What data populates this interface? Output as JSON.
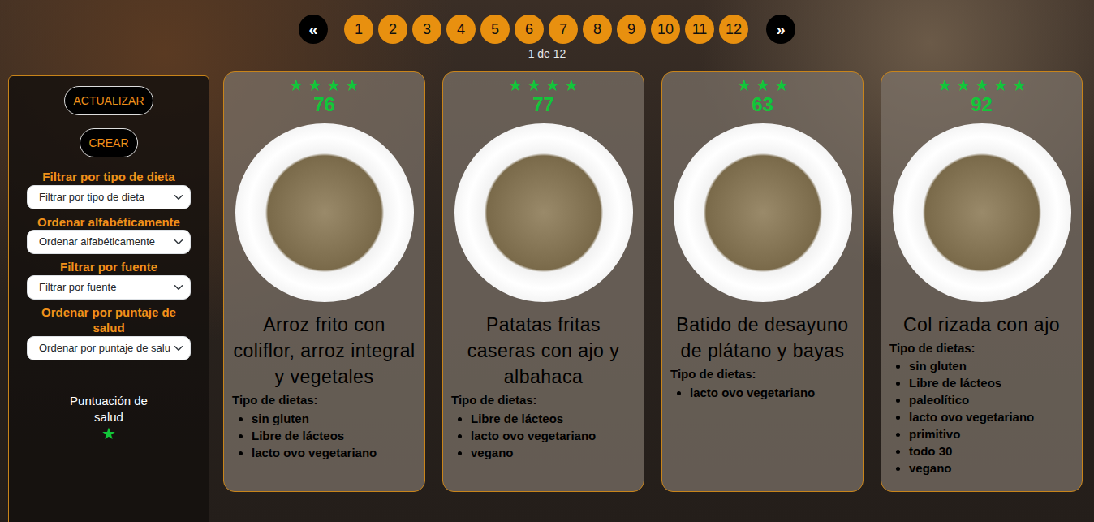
{
  "pagination": {
    "prev": "«",
    "next": "»",
    "pages": [
      "1",
      "2",
      "3",
      "4",
      "5",
      "6",
      "7",
      "8",
      "9",
      "10",
      "11",
      "12"
    ],
    "summary": "1 de 12"
  },
  "sidebar": {
    "buttons": [
      "ACTUALIZAR",
      "CREAR"
    ],
    "filters": [
      {
        "label": "Filtrar por tipo de dieta",
        "value": "Filtrar por tipo de dieta"
      },
      {
        "label": "Ordenar alfabéticamente",
        "value": "Ordenar alfabéticamente"
      },
      {
        "label": "Filtrar por fuente",
        "value": "Filtrar por fuente"
      },
      {
        "label": "Ordenar por puntaje de salud",
        "value": "Ordenar por puntaje de salu"
      }
    ],
    "legend": {
      "label": "Puntuación de salud",
      "stars": 1
    }
  },
  "recipes": [
    {
      "stars": 4,
      "score": "76",
      "title": "Arroz frito con coliflor, arroz integral y vegetales",
      "diets_label": "Tipo de dietas:",
      "diets": [
        "sin gluten",
        "Libre de lácteos",
        "lacto ovo vegetariano"
      ]
    },
    {
      "stars": 4,
      "score": "77",
      "title": "Patatas fritas caseras con ajo y albahaca",
      "diets_label": "Tipo de dietas:",
      "diets": [
        "Libre de lácteos",
        "lacto ovo vegetariano",
        "vegano"
      ]
    },
    {
      "stars": 3,
      "score": "63",
      "title": "Batido de desayuno de plátano y bayas",
      "diets_label": "Tipo de dietas:",
      "diets": [
        "lacto ovo vegetariano"
      ]
    },
    {
      "stars": 5,
      "score": "92",
      "title": "Col rizada con ajo",
      "diets_label": "Tipo de dietas:",
      "diets": [
        "sin gluten",
        "Libre de lácteos",
        "paleolítico",
        "lacto ovo vegetariano",
        "primitivo",
        "todo 30",
        "vegano"
      ]
    }
  ]
}
